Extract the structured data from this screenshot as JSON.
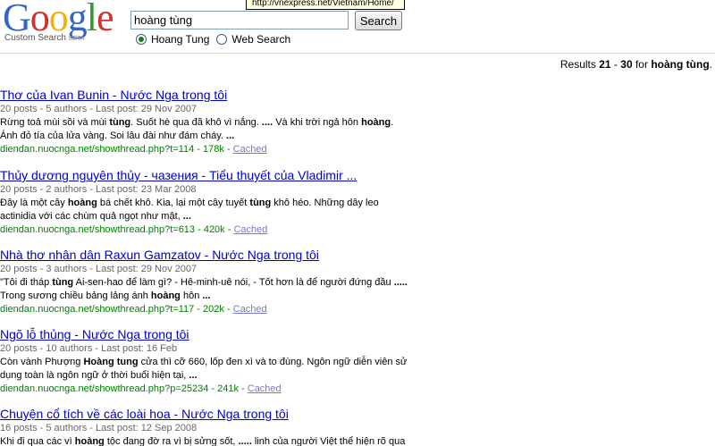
{
  "logo": {
    "letters": [
      {
        "char": "G",
        "color": "#3366cc"
      },
      {
        "char": "o",
        "color": "#cc3333"
      },
      {
        "char": "o",
        "color": "#eeb211"
      },
      {
        "char": "g",
        "color": "#3366cc"
      },
      {
        "char": "l",
        "color": "#339933"
      },
      {
        "char": "e",
        "color": "#cc3333"
      }
    ],
    "subtitle": "Custom Search",
    "beta": "BETA"
  },
  "tooltip": "http://vnexpress.net/Vietnam/Home/",
  "search": {
    "query": "hoàng tùng",
    "button_label": "Search"
  },
  "radios": [
    {
      "label": "Hoang Tung",
      "checked": true
    },
    {
      "label": "Web Search",
      "checked": false
    }
  ],
  "results_summary": {
    "prefix": "Results",
    "start": "21",
    "dash": "-",
    "end": "30",
    "for_label": "for",
    "query": "hoàng tùng",
    "suffix": "."
  },
  "results": [
    {
      "title": "Thơ của Ivan Bunin - Nước Nga trong tôi",
      "meta": "20 posts - 5 authors - Last post: 29 Nov 2007",
      "snippet": [
        [
          {
            "t": "Rừng toả mùi sồi và mùi "
          },
          {
            "t": "tùng",
            "b": true
          },
          {
            "t": ". Suốt hè qua đã khô vì nắng. "
          },
          {
            "t": "....",
            "b": true
          },
          {
            "t": " Và khi trời ngả hôn "
          },
          {
            "t": "hoàng",
            "b": true
          },
          {
            "t": "."
          }
        ],
        [
          {
            "t": "Ánh đỏ tía của lửa vàng. Soi lâu đài như đám cháy. "
          },
          {
            "t": "...",
            "b": true
          }
        ]
      ],
      "url": "diendan.nuocnga.net/showthread.php?t=114 - 178k - ",
      "cached": "Cached"
    },
    {
      "title": "Thủy dương nguyên thủy - чазения - Tiểu thuyết của Vladimir ...",
      "meta": "20 posts - 2 authors - Last post: 23 Mar 2008",
      "snippet": [
        [
          {
            "t": "Đây là một cây "
          },
          {
            "t": "hoàng",
            "b": true
          },
          {
            "t": " bá chết khô. Kia, lại một cây tuyết "
          },
          {
            "t": "tùng",
            "b": true
          },
          {
            "t": " khô héo. Những dây leo"
          }
        ],
        [
          {
            "t": "actinidia với các chùm quả ngọt như mật, "
          },
          {
            "t": "...",
            "b": true
          }
        ]
      ],
      "url": "diendan.nuocnga.net/showthread.php?t=613 - 420k - ",
      "cached": "Cached"
    },
    {
      "title": "Nhà thơ nhân dân Raxun Gamzatov - Nước Nga trong tôi",
      "meta": "20 posts - 3 authors - Last post: 29 Nov 2007",
      "snippet": [
        [
          {
            "t": "\"Tôi đi tháp "
          },
          {
            "t": "tùng",
            "b": true
          },
          {
            "t": " Ai-sen-hao để làm gì? - Hê-minh-uê nói, - Tốt hơn là để người đứng đầu "
          },
          {
            "t": ".....",
            "b": true
          }
        ],
        [
          {
            "t": "Trong sương chiều bảng lảng ánh "
          },
          {
            "t": "hoàng",
            "b": true
          },
          {
            "t": " hôn "
          },
          {
            "t": "...",
            "b": true
          }
        ]
      ],
      "url": "diendan.nuocnga.net/showthread.php?t=117 - 202k - ",
      "cached": "Cached"
    },
    {
      "title": "Ngõ lỗ thủng - Nước Nga trong tôi",
      "meta": "20 posts - 10 authors - Last post: 16 Feb",
      "snippet": [
        [
          {
            "t": "Còn vành Phượng "
          },
          {
            "t": "Hoàng tung",
            "b": true
          },
          {
            "t": " cửa thì cỡ 660, lốp đen xì và to đùng. Ngôn ngữ diễn viên sử"
          }
        ],
        [
          {
            "t": "dụng toàn là ngôn ngữ ở thời buổi hiện tại, "
          },
          {
            "t": "...",
            "b": true
          }
        ]
      ],
      "url": "diendan.nuocnga.net/showthread.php?p=25234 - 241k - ",
      "cached": "Cached"
    },
    {
      "title": "Chuyện cổ tích về các loài hoa - Nước Nga trong tôi",
      "meta": "16 posts - 5 authors - Last post: 12 Sep 2008",
      "snippet": [
        [
          {
            "t": "Khi đi qua các vì "
          },
          {
            "t": "hoàng",
            "b": true
          },
          {
            "t": " tộc đang đờ ra vì bị sửng sốt, "
          },
          {
            "t": ".....",
            "b": true
          },
          {
            "t": " linh của người Việt thể hiện rõ qua"
          }
        ]
      ],
      "url": "",
      "cached": ""
    }
  ]
}
